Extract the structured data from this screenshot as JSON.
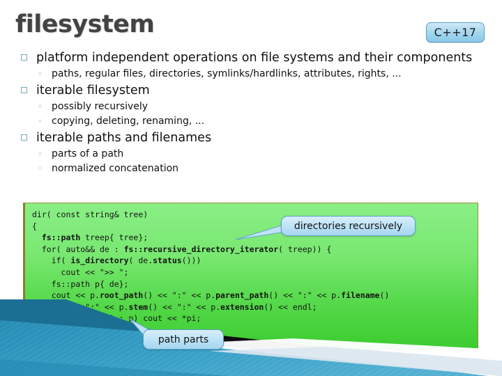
{
  "slide": {
    "title": "filesystem",
    "badge_label": "C++17",
    "accent_color": "#7aa7b8",
    "badge_color": "#aad9ef",
    "code_bg_color": "#52d747",
    "title_color": "#434343"
  },
  "bullets": [
    {
      "level": 1,
      "marker": "square",
      "text": "platform independent operations on file systems and their components"
    },
    {
      "level": 2,
      "marker": "circle",
      "text": "paths, regular files, directories, symlinks/hardlinks, attributes, rights, ..."
    },
    {
      "level": 1,
      "marker": "square",
      "text": "iterable filesystem"
    },
    {
      "level": 2,
      "marker": "circle",
      "text": "possibly recursively"
    },
    {
      "level": 2,
      "marker": "circle",
      "text": "copying, deleting, renaming, ..."
    },
    {
      "level": 1,
      "marker": "square",
      "text": "iterable paths and filenames"
    },
    {
      "level": 2,
      "marker": "circle",
      "text": "parts of a path"
    },
    {
      "level": 2,
      "marker": "circle",
      "text": "normalized concatenation"
    }
  ],
  "code": {
    "language": "cpp",
    "lines": [
      "dir( const string& tree)",
      "{",
      "  <b>fs::path</b> treep{ tree};",
      "  for( auto&& de : <b>fs::recursive_directory_iterator</b>( treep)) {",
      "    if( <b>is_directory</b>( de.<b>status</b>()))",
      "      cout << \">> \";",
      "    fs::path p{ de};",
      "    cout << p.<b>root_path</b>() << \":\" << p.<b>parent_path</b>() << \":\" << p.<b>filename</b>()",
      "        << \":\" << p.<b>stem</b>() << \":\" << p.<b>extension</b>() << endl;",
      "    <b>for</b>(auto&& pi : p) cout << *pi;",
      "  }",
      "}"
    ]
  },
  "callouts": [
    {
      "id": "recursive",
      "text": "directories recursively"
    },
    {
      "id": "parts",
      "text": "path parts"
    }
  ]
}
